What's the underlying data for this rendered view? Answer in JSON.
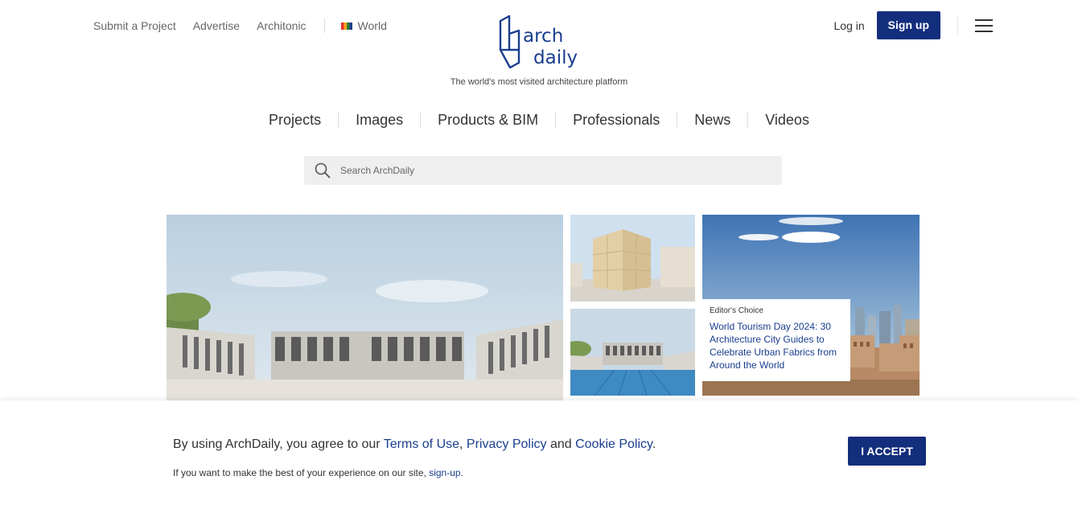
{
  "top_links": {
    "submit": "Submit a Project",
    "advertise": "Advertise",
    "architonic": "Architonic",
    "world": "World"
  },
  "logo": {
    "line1": "arch",
    "line2": "daily",
    "tagline": "The world's most visited architecture platform"
  },
  "auth": {
    "login": "Log in",
    "signup": "Sign up"
  },
  "main_nav": {
    "projects": "Projects",
    "images": "Images",
    "products": "Products & BIM",
    "professionals": "Professionals",
    "news": "News",
    "videos": "Videos"
  },
  "search": {
    "placeholder": "Search ArchDaily"
  },
  "feature": {
    "tag": "Editor's Choice",
    "title": "World Tourism Day 2024: 30 Architecture City Guides to Celebrate Urban Fabrics from Around the World"
  },
  "cookie": {
    "prefix": "By using ArchDaily, you agree to our ",
    "terms": "Terms of Use",
    "comma": ", ",
    "privacy": "Privacy Policy",
    "and": " and ",
    "cookie_policy": "Cookie Policy",
    "period": ".",
    "sub_prefix": "If you want to make the best of your experience on our site, ",
    "signup_link": "sign-up",
    "sub_period": ".",
    "accept": "I ACCEPT"
  },
  "colors": {
    "brand_navy": "#132e7c",
    "link_blue": "#1a3e8f"
  }
}
